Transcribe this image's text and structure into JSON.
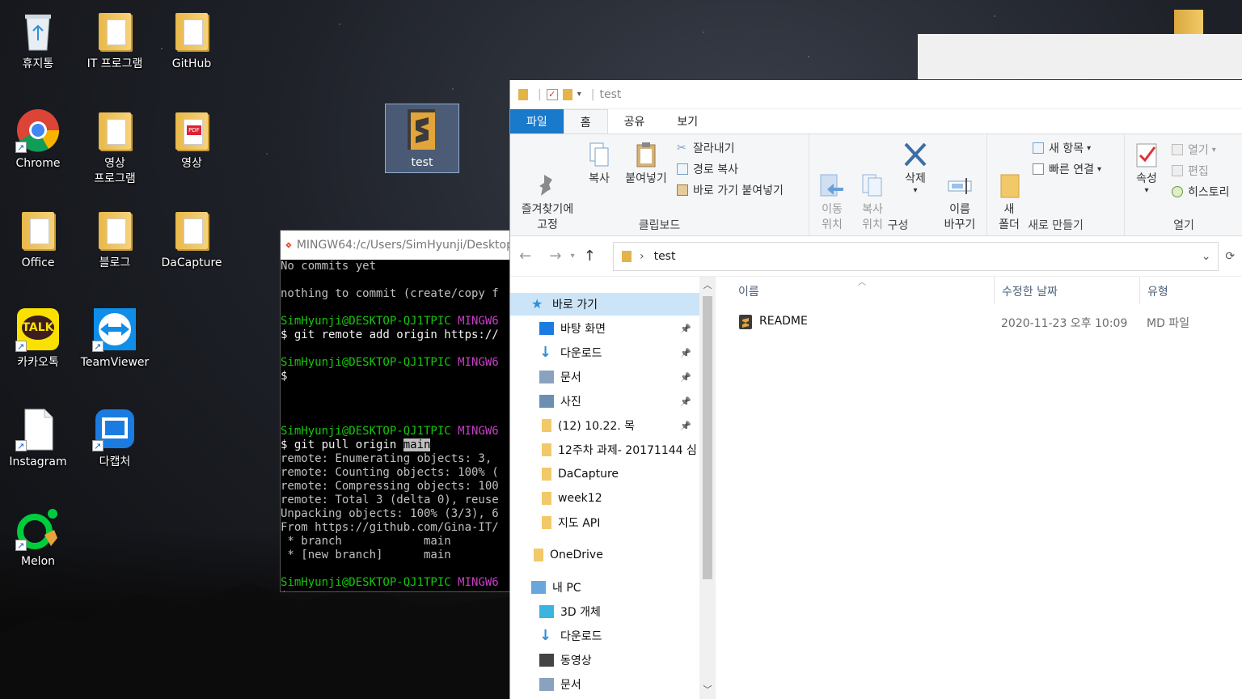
{
  "desktop": {
    "icons": [
      {
        "label": "휴지통",
        "icon": "recycle-bin-icon"
      },
      {
        "label": "IT 프로그램",
        "icon": "folder-icon"
      },
      {
        "label": "GitHub",
        "icon": "folder-icon"
      },
      {
        "label": "Chrome",
        "icon": "chrome-icon"
      },
      {
        "label": "영상\n프로그램",
        "icon": "folder-icon"
      },
      {
        "label": "영상",
        "icon": "folder-pdf-icon"
      },
      {
        "label": "Office",
        "icon": "folder-icon"
      },
      {
        "label": "블로그",
        "icon": "folder-icon"
      },
      {
        "label": "DaCapture",
        "icon": "folder-icon"
      },
      {
        "label": "카카오톡",
        "icon": "kakaotalk-icon"
      },
      {
        "label": "TeamViewer",
        "icon": "teamviewer-icon"
      },
      {
        "label": "Instagram",
        "icon": "file-icon"
      },
      {
        "label": "다캡처",
        "icon": "dacapture-icon"
      },
      {
        "label": "Melon",
        "icon": "melon-icon"
      }
    ],
    "selected_folder": {
      "label": "test",
      "icon": "sublime-folder-icon"
    },
    "kakao_badge": "TALK"
  },
  "terminal": {
    "title": "MINGW64:/c/Users/SimHyunji/Desktop",
    "lines": [
      [
        [
          "No commits yet",
          "t"
        ]
      ],
      [
        [
          "",
          "t"
        ]
      ],
      [
        [
          "nothing to commit (create/copy f",
          "t"
        ]
      ],
      [
        [
          "",
          "t"
        ]
      ],
      [
        [
          "SimHyunji@DESKTOP-QJ1TPIC ",
          "g"
        ],
        [
          "MINGW6",
          "m"
        ]
      ],
      [
        [
          "$ git remote add origin https://",
          "w"
        ]
      ],
      [
        [
          "",
          "t"
        ]
      ],
      [
        [
          "SimHyunji@DESKTOP-QJ1TPIC ",
          "g"
        ],
        [
          "MINGW6",
          "m"
        ]
      ],
      [
        [
          "$",
          "w"
        ]
      ],
      [
        [
          "",
          "t"
        ]
      ],
      [
        [
          "",
          "t"
        ]
      ],
      [
        [
          "",
          "t"
        ]
      ],
      [
        [
          "SimHyunji@DESKTOP-QJ1TPIC ",
          "g"
        ],
        [
          "MINGW6",
          "m"
        ]
      ],
      [
        [
          "$ git pull origin ",
          "w"
        ],
        [
          "main",
          "hl"
        ]
      ],
      [
        [
          "remote: Enumerating objects: 3, ",
          "t"
        ]
      ],
      [
        [
          "remote: Counting objects: 100% (",
          "t"
        ]
      ],
      [
        [
          "remote: Compressing objects: 100",
          "t"
        ]
      ],
      [
        [
          "remote: Total 3 (delta 0), reuse",
          "t"
        ]
      ],
      [
        [
          "Unpacking objects: 100% (3/3), 6",
          "t"
        ]
      ],
      [
        [
          "From https://github.com/Gina-IT/",
          "t"
        ]
      ],
      [
        [
          " * branch            main",
          "t"
        ]
      ],
      [
        [
          " * [new branch]      main",
          "t"
        ]
      ],
      [
        [
          "",
          "t"
        ]
      ],
      [
        [
          "SimHyunji@DESKTOP-QJ1TPIC ",
          "g"
        ],
        [
          "MINGW6",
          "m"
        ]
      ],
      [
        [
          "$ ",
          "w"
        ]
      ]
    ]
  },
  "explorer": {
    "title": "test",
    "tabs": {
      "file": "파일",
      "home": "홈",
      "share": "공유",
      "view": "보기"
    },
    "ribbon": {
      "clipboard": {
        "label": "클립보드",
        "pin": "즐겨찾기에\n고정",
        "copy": "복사",
        "paste": "붙여넣기",
        "cut": "잘라내기",
        "copy_path": "경로 복사",
        "paste_shortcut": "바로 가기 붙여넣기"
      },
      "organize": {
        "label": "구성",
        "move_to": "이동\n위치",
        "copy_to": "복사\n위치",
        "delete": "삭제",
        "rename": "이름\n바꾸기"
      },
      "new": {
        "label": "새로 만들기",
        "new_folder": "새\n폴더",
        "new_item": "새 항목",
        "easy_access": "빠른 연결"
      },
      "open": {
        "label": "열기",
        "properties": "속성",
        "open": "열기",
        "edit": "편집",
        "history": "히스토리"
      }
    },
    "address": {
      "path": "test"
    },
    "nav": [
      {
        "label": "바로 가기",
        "icon": "star-icon",
        "selected": true
      },
      {
        "label": "바탕 화면",
        "icon": "desktop-icon",
        "pinned": true
      },
      {
        "label": "다운로드",
        "icon": "download-icon",
        "pinned": true
      },
      {
        "label": "문서",
        "icon": "document-icon",
        "pinned": true
      },
      {
        "label": "사진",
        "icon": "picture-icon",
        "pinned": true
      },
      {
        "label": "(12) 10.22. 목",
        "icon": "folder-icon",
        "pinned": true
      },
      {
        "label": "12주차 과제- 20171144 심",
        "icon": "folder-icon"
      },
      {
        "label": "DaCapture",
        "icon": "folder-icon"
      },
      {
        "label": "week12",
        "icon": "folder-icon"
      },
      {
        "label": "지도 API",
        "icon": "folder-icon"
      },
      {
        "label": "OneDrive",
        "icon": "onedrive-icon"
      },
      {
        "label": "내 PC",
        "icon": "pc-icon"
      },
      {
        "label": "3D 개체",
        "icon": "cube-icon"
      },
      {
        "label": "다운로드",
        "icon": "download-icon"
      },
      {
        "label": "동영상",
        "icon": "video-icon"
      },
      {
        "label": "문서",
        "icon": "document-icon"
      }
    ],
    "columns": {
      "name": "이름",
      "modified": "수정한 날짜",
      "type": "유형"
    },
    "files": [
      {
        "name": "README",
        "modified": "2020-11-23 오후 10:09",
        "type": "MD 파일",
        "icon": "sublime-file-icon"
      }
    ]
  },
  "colors": {
    "accent": "#1979ca",
    "terminal_green": "#16c60c",
    "terminal_magenta": "#c93ec9"
  }
}
